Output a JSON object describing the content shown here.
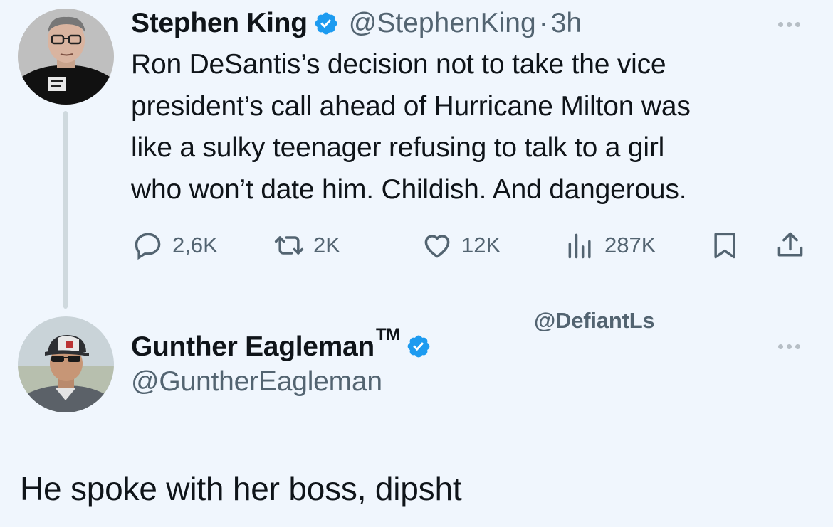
{
  "original_tweet": {
    "author_name": "Stephen King",
    "handle": "@StephenKing",
    "separator": "·",
    "time": "3h",
    "verified": true,
    "text": "Ron DeSantis’s decision not to take the vice president’s call ahead of Hurricane Milton was like a sulky teenager refusing to talk to a girl who won’t date him. Childish. And dangerous.",
    "text_lines": [
      "Ron DeSantis’s decision not to take the vice",
      "president’s call ahead of Hurricane Milton was",
      "like a sulky teenager refusing to talk to a girl",
      "who won’t date him. Childish. And dangerous."
    ],
    "actions": {
      "reply_count": "2,6K",
      "retweet_count": "2K",
      "like_count": "12K",
      "views_count": "287K"
    },
    "icons": [
      "reply-icon",
      "retweet-icon",
      "heart-icon",
      "views-icon",
      "bookmark-icon",
      "share-icon",
      "more-icon",
      "verified-badge-icon"
    ]
  },
  "watermark": "@DefiantLs",
  "reply_profile": {
    "author_name": "Gunther Eagleman",
    "trademark": "TM",
    "handle": "@GuntherEagleman",
    "verified": true
  },
  "reply_text": "He spoke with her boss,  dipsht",
  "colors": {
    "background": "#f0f6fd",
    "primary_text": "#0f1419",
    "secondary_text": "#536471",
    "verified_blue": "#1d9bf0"
  }
}
